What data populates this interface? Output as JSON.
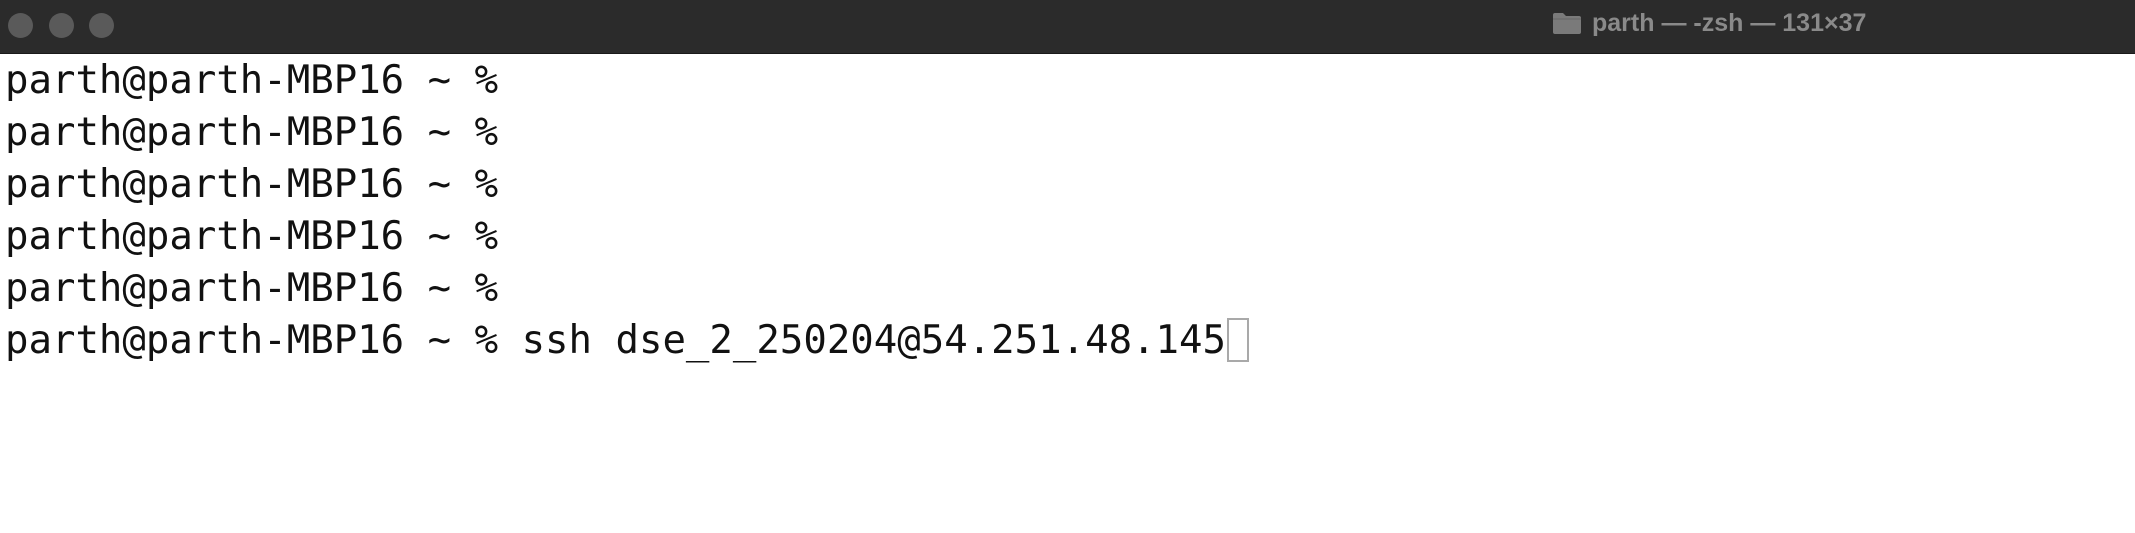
{
  "window": {
    "title": "parth — -zsh — 131×37",
    "title_icon": "folder-icon"
  },
  "terminal": {
    "lines": [
      {
        "prompt": "parth@parth-MBP16 ~ %",
        "command": ""
      },
      {
        "prompt": "parth@parth-MBP16 ~ %",
        "command": ""
      },
      {
        "prompt": "parth@parth-MBP16 ~ %",
        "command": ""
      },
      {
        "prompt": "parth@parth-MBP16 ~ %",
        "command": ""
      },
      {
        "prompt": "parth@parth-MBP16 ~ %",
        "command": ""
      },
      {
        "prompt": "parth@parth-MBP16 ~ %",
        "command": " ssh dse_2_250204@54.251.48.145"
      }
    ]
  },
  "colors": {
    "titlebar": "#2b2b2b",
    "title_text": "#8a8a8a",
    "text": "#111111",
    "background": "#ffffff"
  }
}
